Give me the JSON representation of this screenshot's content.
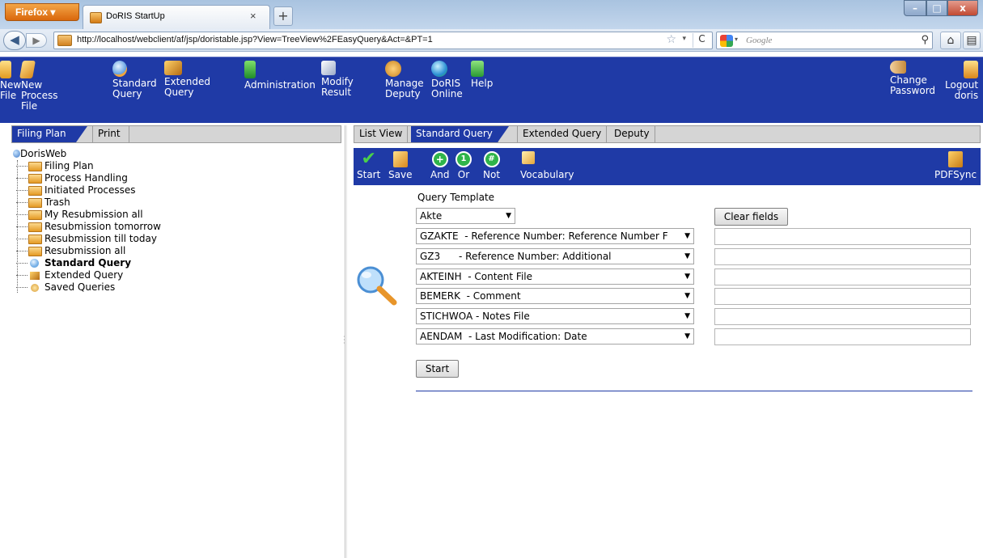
{
  "browser": {
    "menu_button": "Firefox",
    "tab_title": "DoRIS StartUp",
    "new_tab": "+",
    "url": "http://localhost/webclient/af/jsp/doristable.jsp?View=TreeView%2FEasyQuery&Act=&PT=1",
    "search_placeholder": "Google",
    "window_controls": [
      "–",
      "□",
      "x"
    ]
  },
  "toolbar": {
    "items": [
      {
        "label": "New\nFile",
        "icon": "new-file-icon"
      },
      {
        "label": "New\nProcess\nFile",
        "icon": "new-process-file-icon"
      },
      {
        "label": "Standard\nQuery",
        "icon": "standard-query-icon"
      },
      {
        "label": "Extended\nQuery",
        "icon": "extended-query-icon"
      },
      {
        "label": "Administration",
        "icon": "administration-icon"
      },
      {
        "label": "Modify\nResult",
        "icon": "modify-result-icon"
      },
      {
        "label": "Manage\nDeputy",
        "icon": "manage-deputy-icon"
      },
      {
        "label": "DoRIS\nOnline",
        "icon": "doris-online-icon"
      },
      {
        "label": "Help",
        "icon": "help-icon"
      },
      {
        "label": "Change\nPassword",
        "icon": "change-password-icon"
      },
      {
        "label": "Logout\ndoris",
        "icon": "logout-icon"
      }
    ]
  },
  "left_panel": {
    "tabs": [
      "Filing Plan",
      "Print"
    ],
    "tree_root": "DorisWeb",
    "tree_items": [
      {
        "label": "Filing Plan",
        "icon": "folder-icon"
      },
      {
        "label": "Process Handling",
        "icon": "folder-icon"
      },
      {
        "label": "Initiated Processes",
        "icon": "folder-icon"
      },
      {
        "label": "Trash",
        "icon": "folder-icon"
      },
      {
        "label": "My Resubmission all",
        "icon": "folder-icon"
      },
      {
        "label": "Resubmission tomorrow",
        "icon": "folder-icon"
      },
      {
        "label": "Resubmission till today",
        "icon": "folder-icon"
      },
      {
        "label": "Resubmission all",
        "icon": "folder-icon"
      },
      {
        "label": "Standard Query",
        "icon": "magnifier-icon"
      },
      {
        "label": "Extended Query",
        "icon": "extended-query-icon"
      },
      {
        "label": "Saved Queries",
        "icon": "saved-queries-icon"
      }
    ]
  },
  "right_panel": {
    "tabs": [
      "List View",
      "Standard Query",
      "Extended Query",
      "Deputy"
    ],
    "query_toolbar": {
      "items": [
        {
          "label": "Start",
          "icon": "checkmark-icon"
        },
        {
          "label": "Save",
          "icon": "save-icon"
        },
        {
          "label": "And",
          "icon": "plus-circle-icon"
        },
        {
          "label": "Or",
          "icon": "one-circle-icon"
        },
        {
          "label": "Not",
          "icon": "hash-circle-icon"
        },
        {
          "label": "Vocabulary",
          "icon": "vocabulary-icon"
        },
        {
          "label": "PDFSync",
          "icon": "pdfsync-icon"
        }
      ]
    },
    "query_template_label": "Query Template",
    "template_value": "Akte",
    "clear_button": "Clear fields",
    "fields": [
      {
        "selected": "GZAKTE  - Reference Number: Reference Number F",
        "value": ""
      },
      {
        "selected": "GZ3      - Reference Number: Additional",
        "value": ""
      },
      {
        "selected": "AKTEINH  - Content File",
        "value": ""
      },
      {
        "selected": "BEMERK  - Comment",
        "value": ""
      },
      {
        "selected": "STICHWOA - Notes File",
        "value": ""
      },
      {
        "selected": "AENDAM  - Last Modification: Date",
        "value": ""
      }
    ],
    "start_button": "Start"
  }
}
